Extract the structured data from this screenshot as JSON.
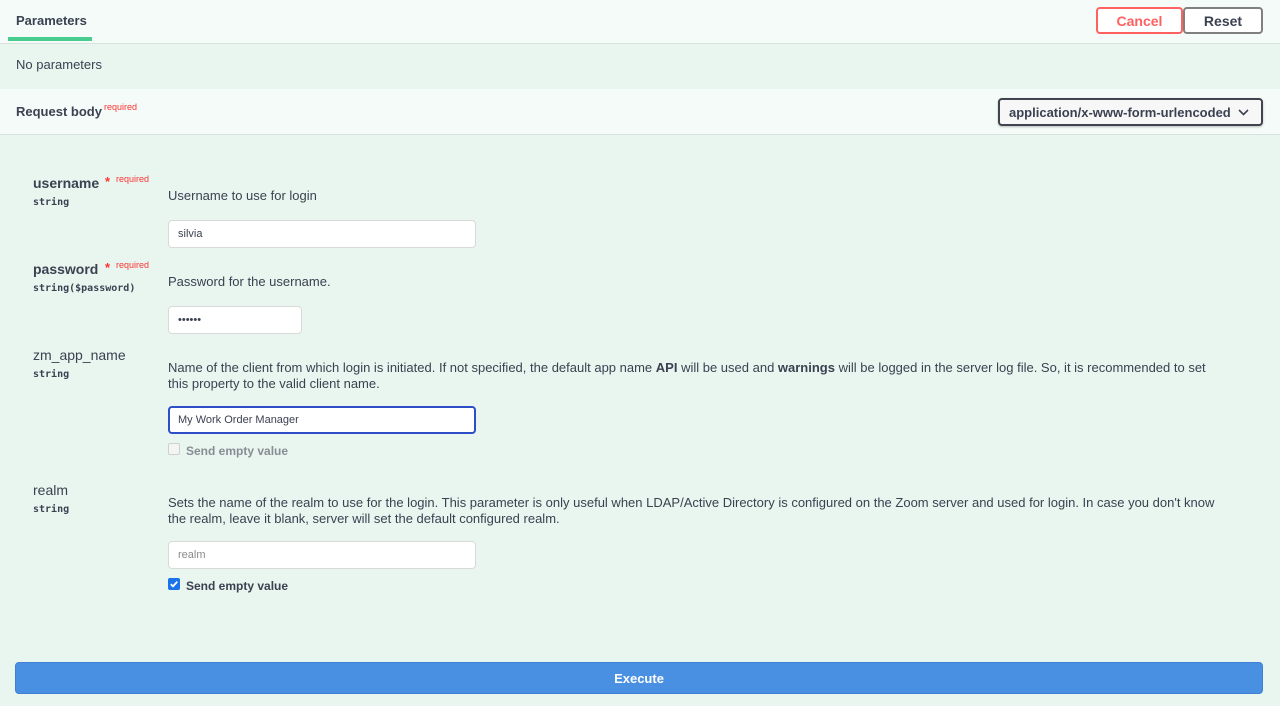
{
  "header": {
    "tab_label": "Parameters",
    "cancel_label": "Cancel",
    "reset_label": "Reset"
  },
  "parameters": {
    "empty_text": "No parameters"
  },
  "request_body": {
    "title": "Request body",
    "required_label": "required",
    "content_type": "application/x-www-form-urlencoded",
    "content_type_icon": "chevron-down-icon"
  },
  "fields": [
    {
      "name": "username",
      "star": "*",
      "required_label": "required",
      "type": "string",
      "description": "Username to use for login",
      "value": "silvia"
    },
    {
      "name": "password",
      "star": "*",
      "required_label": "required",
      "type": "string($password)",
      "description": "Password for the username.",
      "value": "silvia"
    },
    {
      "name": "zm_app_name",
      "type": "string",
      "description_parts": [
        "Name of the client from which login is initiated. If not specified, the default app name ",
        "API",
        " will be used and ",
        "warnings",
        " will be logged in the server log file. So, it is recommended to set this property to the valid client name."
      ],
      "value": "My Work Order Manager",
      "send_empty_label": "Send empty value",
      "send_empty_checked": false
    },
    {
      "name": "realm",
      "type": "string",
      "description": "Sets the name of the realm to use for the login. This parameter is only useful when LDAP/Active Directory is configured on the Zoom server and used for login. In case you don't know the realm, leave it blank, server will set the default configured realm.",
      "value": "",
      "placeholder": "realm",
      "send_empty_label": "Send empty value",
      "send_empty_checked": true
    }
  ],
  "execute_label": "Execute",
  "colors": {
    "background": "#e8f6ef",
    "tab_underline": "#49cc90",
    "cancel": "#ff6060",
    "required": "#ff3333",
    "execute": "#4990e2",
    "focus_border": "#2d4ec6"
  }
}
